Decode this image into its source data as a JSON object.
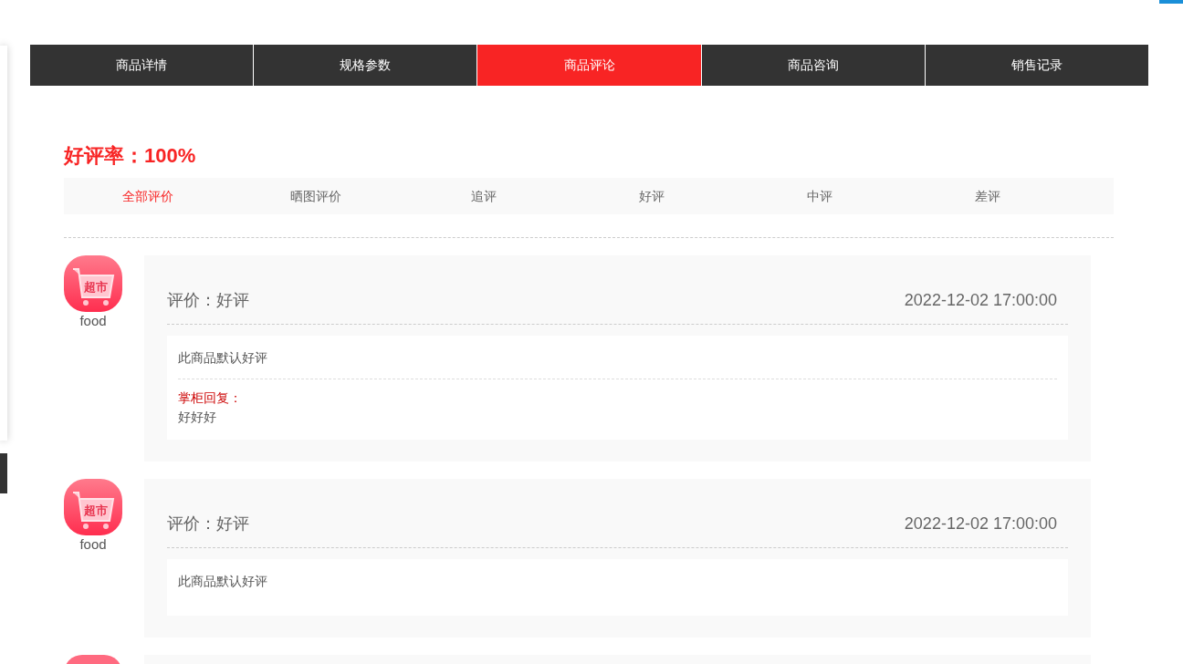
{
  "tabs": [
    {
      "label": "商品详情",
      "selected": false
    },
    {
      "label": "规格参数",
      "selected": false
    },
    {
      "label": "商品评论",
      "selected": true
    },
    {
      "label": "商品咨询",
      "selected": false
    },
    {
      "label": "销售记录",
      "selected": false
    }
  ],
  "rating": {
    "label": "好评率：",
    "value": "100%"
  },
  "filters": [
    {
      "label": "全部评价",
      "selected": true
    },
    {
      "label": "晒图评价",
      "selected": false
    },
    {
      "label": "追评",
      "selected": false
    },
    {
      "label": "好评",
      "selected": false
    },
    {
      "label": "中评",
      "selected": false
    },
    {
      "label": "差评",
      "selected": false
    }
  ],
  "reviews": [
    {
      "avatar_text": "超市",
      "user": "food",
      "verdict": "评价：好评",
      "time": "2022-12-02 17:00:00",
      "content": "此商品默认好评",
      "reply": {
        "label": "掌柜回复：",
        "text": "好好好"
      }
    },
    {
      "avatar_text": "超市",
      "user": "food",
      "verdict": "评价：好评",
      "time": "2022-12-02 17:00:00",
      "content": "此商品默认好评"
    }
  ]
}
